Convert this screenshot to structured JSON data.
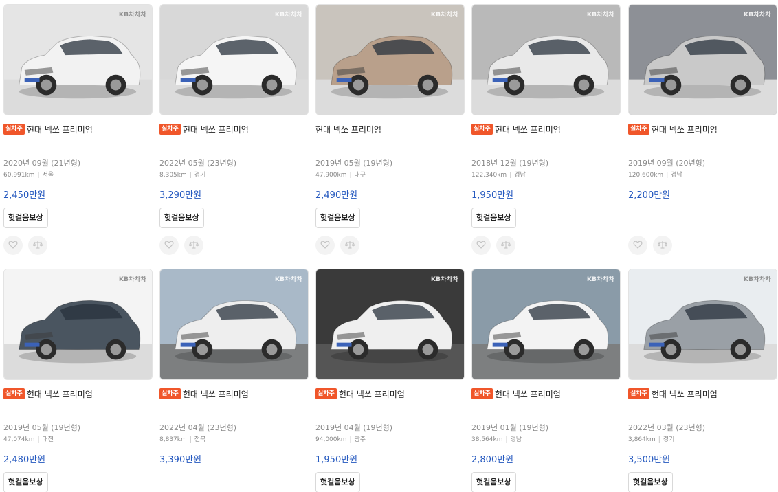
{
  "listing": {
    "badge_label": "실차주",
    "trade_in_label": "헛걸음보상",
    "watermark": "KB차차차",
    "cards": [
      {
        "title": "현대 넥쏘 프리미엄",
        "badge": true,
        "year": "2020년 09월 (21년형)",
        "mileage": "60,991km",
        "region": "서울",
        "price": "2,450만원",
        "trade_in": true,
        "actions": true
      },
      {
        "title": "현대 넥쏘 프리미엄",
        "badge": true,
        "year": "2022년 05월 (23년형)",
        "mileage": "8,305km",
        "region": "경기",
        "price": "3,290만원",
        "trade_in": true,
        "actions": true
      },
      {
        "title": "현대 넥쏘 프리미엄",
        "badge": false,
        "year": "2019년 05월 (19년형)",
        "mileage": "47,900km",
        "region": "대구",
        "price": "2,490만원",
        "trade_in": true,
        "actions": true
      },
      {
        "title": "현대 넥쏘 프리미엄",
        "badge": true,
        "year": "2018년 12월 (19년형)",
        "mileage": "122,340km",
        "region": "경남",
        "price": "1,950만원",
        "trade_in": true,
        "actions": true
      },
      {
        "title": "현대 넥쏘 프리미엄",
        "badge": true,
        "year": "2019년 09월 (20년형)",
        "mileage": "120,600km",
        "region": "경남",
        "price": "2,200만원",
        "trade_in": false,
        "actions": true
      },
      {
        "title": "현대 넥쏘 프리미엄",
        "badge": true,
        "year": "2019년 05월 (19년형)",
        "mileage": "47,074km",
        "region": "대전",
        "price": "2,480만원",
        "trade_in": true,
        "actions": false
      },
      {
        "title": "현대 넥쏘 프리미엄",
        "badge": true,
        "year": "2022년 04월 (23년형)",
        "mileage": "8,837km",
        "region": "전북",
        "price": "3,390만원",
        "trade_in": false,
        "actions": false
      },
      {
        "title": "현대 넥쏘 프리미엄",
        "badge": true,
        "year": "2019년 04월 (19년형)",
        "mileage": "94,000km",
        "region": "광주",
        "price": "1,950만원",
        "trade_in": true,
        "actions": false
      },
      {
        "title": "현대 넥쏘 프리미엄",
        "badge": true,
        "year": "2019년 01월 (19년형)",
        "mileage": "38,564km",
        "region": "경남",
        "price": "2,800만원",
        "trade_in": true,
        "actions": false
      },
      {
        "title": "현대 넥쏘 프리미엄",
        "badge": true,
        "year": "2022년 03월 (23년형)",
        "mileage": "3,864km",
        "region": "경기",
        "price": "3,500만원",
        "trade_in": true,
        "actions": false
      }
    ],
    "photo_colors": {
      "car_bodies": [
        "#f2f2f2",
        "#f5f5f5",
        "#b9a08b",
        "#e9e9e9",
        "#c9c9c9",
        "#4a5560",
        "#eeeeee",
        "#efefef",
        "#f3f3f3",
        "#9aa0a6"
      ],
      "backgrounds": [
        "#e5e5e5",
        "#d8d8d8",
        "#c9c4bd",
        "#b9b9b9",
        "#8d9096",
        "#f4f4f4",
        "#a9b9c8",
        "#3a3a3a",
        "#8a9ba8",
        "#e9edf0"
      ]
    },
    "colors": {
      "badge": "#f0562a",
      "price": "#2458bf",
      "muted": "#8a8a8a"
    }
  }
}
